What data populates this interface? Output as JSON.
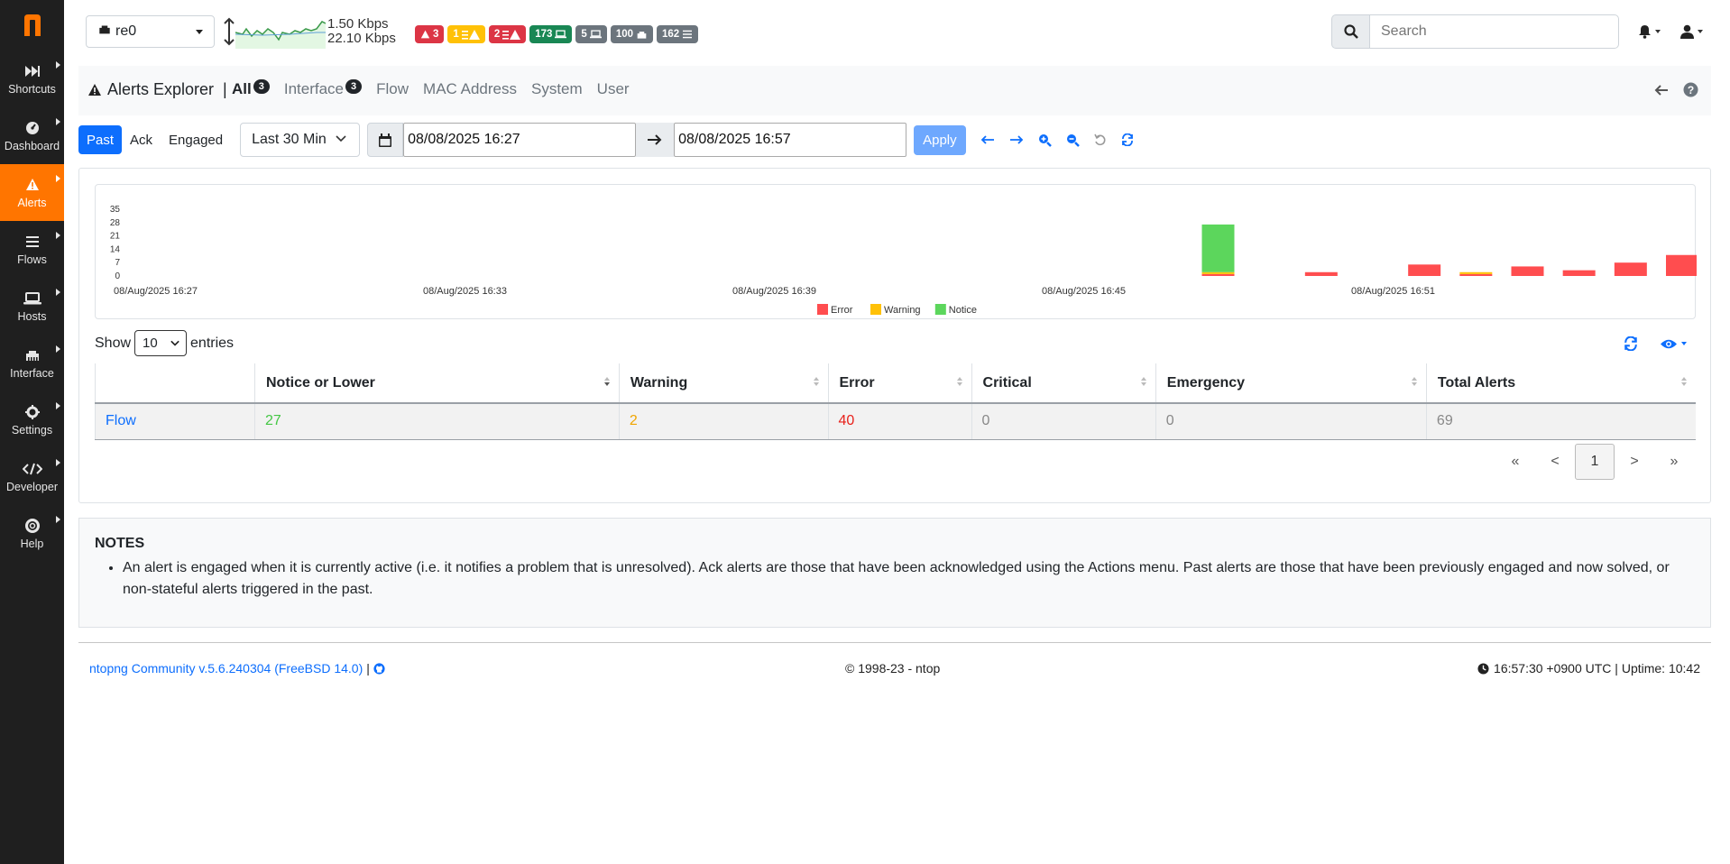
{
  "sidebar": {
    "items": [
      {
        "label": "Shortcuts",
        "icon": "fast-forward-icon"
      },
      {
        "label": "Dashboard",
        "icon": "gauge-icon"
      },
      {
        "label": "Alerts",
        "icon": "warning-icon",
        "active": true
      },
      {
        "label": "Flows",
        "icon": "bars-icon"
      },
      {
        "label": "Hosts",
        "icon": "laptop-icon"
      },
      {
        "label": "Interface",
        "icon": "ethernet-icon"
      },
      {
        "label": "Settings",
        "icon": "cog-icon"
      },
      {
        "label": "Developer",
        "icon": "code-icon"
      },
      {
        "label": "Help",
        "icon": "lifebuoy-icon"
      }
    ]
  },
  "topbar": {
    "interface": "re0",
    "upload_rate": "1.50 Kbps",
    "download_rate": "22.10 Kbps",
    "badges": [
      {
        "value": "3",
        "color": "#dc3545",
        "icon": "warning-icon"
      },
      {
        "value": "1",
        "color": "#ffc107",
        "icon": "list-warning-icon"
      },
      {
        "value": "2",
        "color": "#dc3545",
        "icon": "list-warning-icon"
      },
      {
        "value": "173",
        "color": "#198754",
        "icon": "laptop-icon"
      },
      {
        "value": "5",
        "color": "#6c757d",
        "icon": "laptop-icon"
      },
      {
        "value": "100",
        "color": "#6c757d",
        "icon": "ethernet-icon"
      },
      {
        "value": "162",
        "color": "#6c757d",
        "icon": "bars-icon"
      }
    ],
    "search_placeholder": "Search"
  },
  "nav": {
    "title": "Alerts Explorer",
    "separator": "|",
    "tabs": [
      {
        "label": "All",
        "count": "3",
        "active": true
      },
      {
        "label": "Interface",
        "count": "3"
      },
      {
        "label": "Flow"
      },
      {
        "label": "MAC Address"
      },
      {
        "label": "System"
      },
      {
        "label": "User"
      }
    ]
  },
  "filters": {
    "past": "Past",
    "ack": "Ack",
    "engaged": "Engaged",
    "range": "Last 30 Min",
    "from": "08/08/2025 16:27",
    "to": "08/08/2025 16:57",
    "apply": "Apply"
  },
  "chart_data": {
    "type": "bar",
    "stacked": true,
    "y_ticks": [
      "35",
      "28",
      "21",
      "14",
      "7",
      "0"
    ],
    "ylim": [
      0,
      35
    ],
    "x_ticks": [
      "08/Aug/2025 16:27",
      "08/Aug/2025 16:33",
      "08/Aug/2025 16:39",
      "08/Aug/2025 16:45",
      "08/Aug/2025 16:51"
    ],
    "legend": [
      {
        "name": "Error",
        "color": "#ff4d4f"
      },
      {
        "name": "Warning",
        "color": "#ffc107"
      },
      {
        "name": "Notice",
        "color": "#5cd65c"
      }
    ],
    "series_colors": {
      "error": "#ff4d4f",
      "warning": "#ffc107",
      "notice": "#5cd65c"
    },
    "bins": [
      {
        "time": "16:48",
        "error": 1,
        "warning": 1,
        "notice": 25
      },
      {
        "time": "16:50",
        "error": 2,
        "warning": 0,
        "notice": 0
      },
      {
        "time": "16:52",
        "error": 6,
        "warning": 0,
        "notice": 0
      },
      {
        "time": "16:53",
        "error": 1,
        "warning": 1,
        "notice": 0
      },
      {
        "time": "16:54",
        "error": 5,
        "warning": 0,
        "notice": 0
      },
      {
        "time": "16:55",
        "error": 3,
        "warning": 0,
        "notice": 0
      },
      {
        "time": "16:56",
        "error": 7,
        "warning": 0,
        "notice": 0
      },
      {
        "time": "16:57",
        "error": 11,
        "warning": 0,
        "notice": 0
      }
    ]
  },
  "table": {
    "show": "Show",
    "entries_value": "10",
    "entries": "entries",
    "columns": [
      "",
      "Notice or Lower",
      "Warning",
      "Error",
      "Critical",
      "Emergency",
      "Total Alerts"
    ],
    "rows": [
      {
        "type": "Flow",
        "notice": "27",
        "warning": "2",
        "error": "40",
        "critical": "0",
        "emergency": "0",
        "total": "69"
      }
    ],
    "pagination": {
      "first": "«",
      "prev": "<",
      "page": "1",
      "next": ">",
      "last": "»"
    }
  },
  "notes": {
    "title": "NOTES",
    "items": [
      "An alert is engaged when it is currently active (i.e. it notifies a problem that is unresolved). Ack alerts are those that have been acknowledged using the Actions menu. Past alerts are those that have been previously engaged and now solved, or non-stateful alerts triggered in the past."
    ]
  },
  "footer": {
    "version": "ntopng Community v.5.6.240304 (FreeBSD 14.0)",
    "copyright": "© 1998-23 - ntop",
    "time": "16:57:30 +0900 UTC | Uptime: 10:42"
  },
  "colors": {
    "sidebar_bg": "#1f1f1f",
    "accent": "#ff7500",
    "primary": "#0d6efd",
    "notice_text": "#44c744",
    "warning_text": "#f0a500",
    "error_text": "#e8211b"
  }
}
